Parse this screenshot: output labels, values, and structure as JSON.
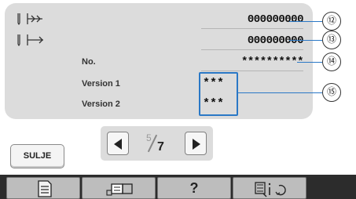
{
  "rows": [
    {
      "value": "000000000"
    },
    {
      "value": "000000000"
    },
    {
      "label": "No.",
      "value": "**********"
    },
    {
      "label": "Version 1",
      "value": "***"
    },
    {
      "label": "Version 2",
      "value": "***"
    }
  ],
  "callouts": [
    "⑫",
    "⑬",
    "⑭",
    "⑮"
  ],
  "buttons": {
    "close": "SULJE",
    "help": "?"
  },
  "pager": {
    "current": "5",
    "total": "7"
  },
  "toolbar_icons": [
    "document-icon",
    "sewing-machine-icon",
    "help-icon",
    "settings-icon"
  ],
  "colors": {
    "panel": "#dcdcdc",
    "highlight_box": "#2a78c6",
    "toolbar": "#2c2c2c",
    "toolbar_button": "#bdbdbd"
  }
}
